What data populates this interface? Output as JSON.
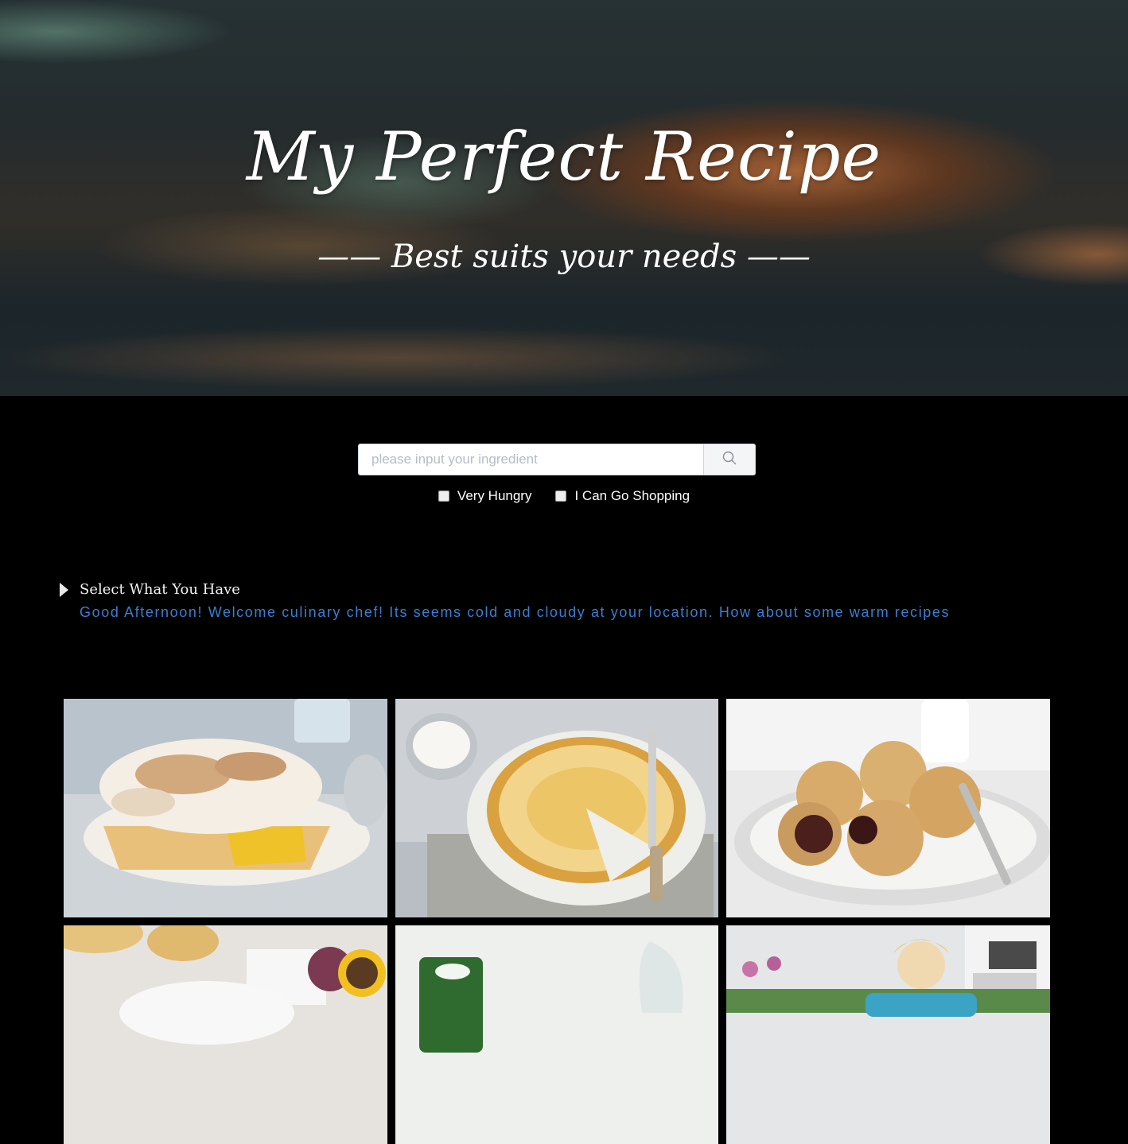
{
  "hero": {
    "title": "My Perfect Recipe",
    "subtitle": "—— Best suits your needs ——"
  },
  "search": {
    "placeholder": "please input your ingredient",
    "value": "",
    "button_icon": "search-icon"
  },
  "filters": [
    {
      "label": "Very Hungry",
      "checked": false
    },
    {
      "label": "I Can Go Shopping",
      "checked": false
    }
  ],
  "ingredients_toggle": {
    "label": "Select What You Have",
    "icon": "caret-right-icon",
    "expanded": false
  },
  "greeting": "Good Afternoon! Welcome culinary chef! Its seems cold and cloudy at your location. How about some warm recipes",
  "colors": {
    "background": "#000000",
    "greeting_text": "#3a7fd0",
    "hero_text": "#ffffff"
  },
  "recipes": [
    {
      "image": "lemon-meringue-pie-image"
    },
    {
      "image": "apple-tart-image"
    },
    {
      "image": "mince-pies-image"
    },
    {
      "image": "passion-fruit-tarts-image"
    },
    {
      "image": "green-smoothie-image"
    },
    {
      "image": "chef-kitchen-video-image"
    }
  ]
}
